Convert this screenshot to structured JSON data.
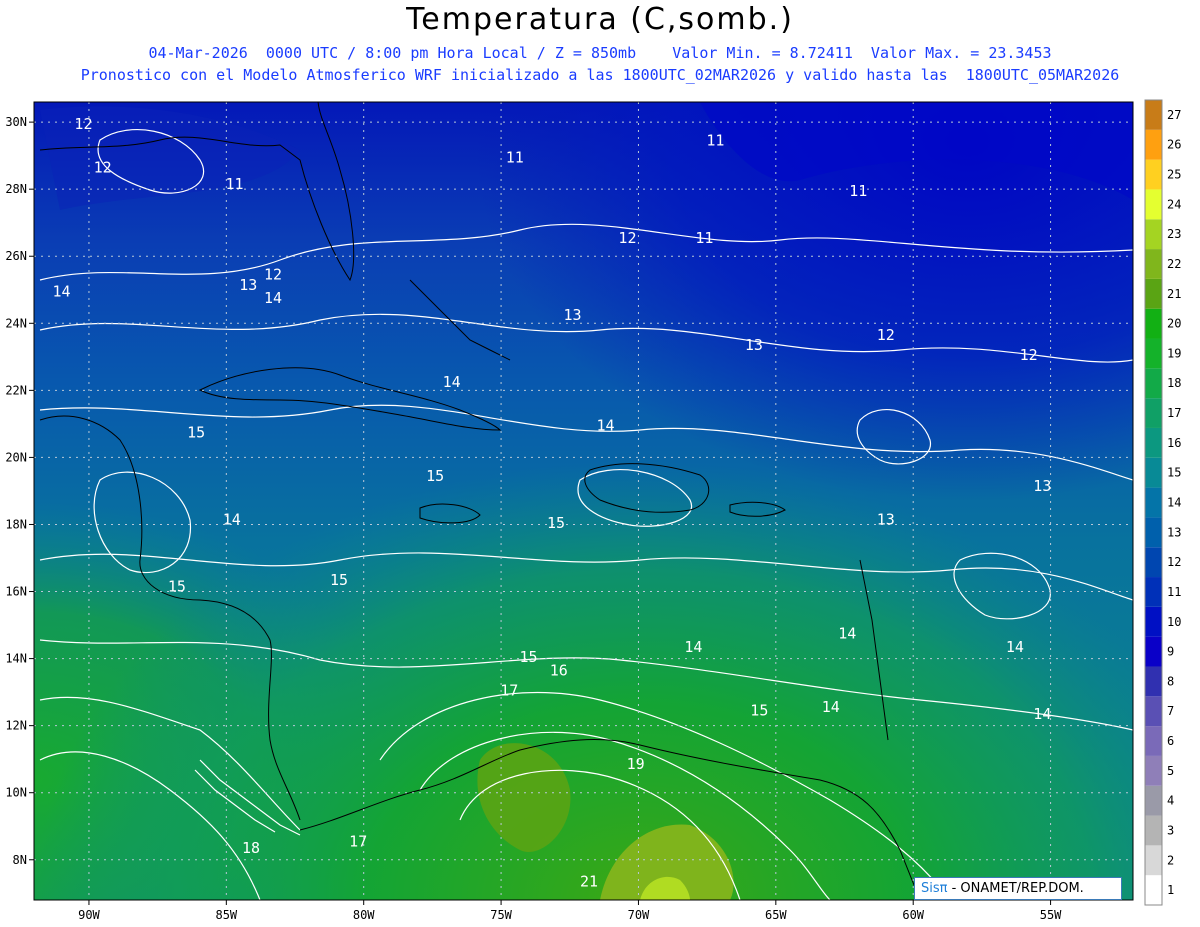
{
  "title": "Temperatura (C,somb.)",
  "subtitle_line1": "04-Mar-2026  0000 UTC / 8:00 pm Hora Local / Z = 850mb    Valor Min. = 8.72411  Valor Max. = 23.3453",
  "subtitle_line2": "Pronostico con el Modelo Atmosferico WRF inicializado a las 1800UTC_02MAR2026 y valido hasta las  1800UTC_05MAR2026",
  "credit": {
    "brand": "Sisπ",
    "text": " - ONAMET/REP.DOM."
  },
  "chart_data": {
    "type": "heatmap",
    "variable": "Temperatura (C,somb.)",
    "level": "850mb",
    "value_min": 8.72411,
    "value_max": 23.3453,
    "xlim": [
      -92,
      -52
    ],
    "ylim": [
      6.8,
      30.6
    ],
    "x_ticks": [
      "90W",
      "85W",
      "80W",
      "75W",
      "70W",
      "65W",
      "60W",
      "55W"
    ],
    "x_tick_values": [
      -90,
      -85,
      -80,
      -75,
      -70,
      -65,
      -60,
      -55
    ],
    "y_ticks": [
      "8N",
      "10N",
      "12N",
      "14N",
      "16N",
      "18N",
      "20N",
      "22N",
      "24N",
      "26N",
      "28N",
      "30N"
    ],
    "y_tick_values": [
      8,
      10,
      12,
      14,
      16,
      18,
      20,
      22,
      24,
      26,
      28,
      30
    ],
    "grid": true,
    "colorbar": {
      "position": "right",
      "levels": [
        1,
        2,
        3,
        4,
        5,
        6,
        7,
        8,
        9,
        10,
        11,
        12,
        13,
        14,
        15,
        16,
        17,
        18,
        19,
        20,
        21,
        22,
        23,
        24,
        25,
        26,
        27
      ],
      "colors": [
        "#ffffff",
        "#d8d8d8",
        "#b4b4b4",
        "#9a9aa8",
        "#8f7fb8",
        "#7a6ab8",
        "#5a50b4",
        "#3030b0",
        "#0a00c8",
        "#0010c4",
        "#0030b8",
        "#0046b0",
        "#0060ac",
        "#0474a8",
        "#088a96",
        "#0c9880",
        "#10a066",
        "#12aa48",
        "#14b22a",
        "#12b014",
        "#5aa414",
        "#80b61c",
        "#a4d422",
        "#e4ff30",
        "#ffd020",
        "#ffa010",
        "#c87c18"
      ]
    },
    "contour_labels": [
      {
        "lon": -90.2,
        "lat": 29.8,
        "value": 12
      },
      {
        "lon": -89.5,
        "lat": 28.5,
        "value": 12
      },
      {
        "lon": -84.7,
        "lat": 28.0,
        "value": 11
      },
      {
        "lon": -74.5,
        "lat": 28.8,
        "value": 11
      },
      {
        "lon": -70.4,
        "lat": 26.4,
        "value": 12
      },
      {
        "lon": -67.6,
        "lat": 26.4,
        "value": 11
      },
      {
        "lon": -67.2,
        "lat": 29.3,
        "value": 11
      },
      {
        "lon": -62.0,
        "lat": 27.8,
        "value": 11
      },
      {
        "lon": -83.3,
        "lat": 25.3,
        "value": 12
      },
      {
        "lon": -84.2,
        "lat": 25.0,
        "value": 13
      },
      {
        "lon": -83.3,
        "lat": 24.6,
        "value": 14
      },
      {
        "lon": -91.0,
        "lat": 24.8,
        "value": 14
      },
      {
        "lon": -72.4,
        "lat": 24.1,
        "value": 13
      },
      {
        "lon": -65.8,
        "lat": 23.2,
        "value": 13
      },
      {
        "lon": -61.0,
        "lat": 23.5,
        "value": 12
      },
      {
        "lon": -55.8,
        "lat": 22.9,
        "value": 12
      },
      {
        "lon": -76.8,
        "lat": 22.1,
        "value": 14
      },
      {
        "lon": -71.2,
        "lat": 20.8,
        "value": 14
      },
      {
        "lon": -86.1,
        "lat": 20.6,
        "value": 15
      },
      {
        "lon": -77.4,
        "lat": 19.3,
        "value": 15
      },
      {
        "lon": -84.8,
        "lat": 18.0,
        "value": 14
      },
      {
        "lon": -73.0,
        "lat": 17.9,
        "value": 15
      },
      {
        "lon": -55.3,
        "lat": 19.0,
        "value": 13
      },
      {
        "lon": -61.0,
        "lat": 18.0,
        "value": 13
      },
      {
        "lon": -86.8,
        "lat": 16.0,
        "value": 15
      },
      {
        "lon": -80.9,
        "lat": 16.2,
        "value": 15
      },
      {
        "lon": -68.0,
        "lat": 14.2,
        "value": 14
      },
      {
        "lon": -62.4,
        "lat": 14.6,
        "value": 14
      },
      {
        "lon": -56.3,
        "lat": 14.2,
        "value": 14
      },
      {
        "lon": -74.0,
        "lat": 13.9,
        "value": 15
      },
      {
        "lon": -72.9,
        "lat": 13.5,
        "value": 16
      },
      {
        "lon": -74.7,
        "lat": 12.9,
        "value": 17
      },
      {
        "lon": -65.6,
        "lat": 12.3,
        "value": 15
      },
      {
        "lon": -63.0,
        "lat": 12.4,
        "value": 14
      },
      {
        "lon": -55.3,
        "lat": 12.2,
        "value": 14
      },
      {
        "lon": -70.1,
        "lat": 10.7,
        "value": 19
      },
      {
        "lon": -84.1,
        "lat": 8.2,
        "value": 18
      },
      {
        "lon": -80.2,
        "lat": 8.4,
        "value": 17
      },
      {
        "lon": -71.8,
        "lat": 7.2,
        "value": 21
      }
    ]
  }
}
